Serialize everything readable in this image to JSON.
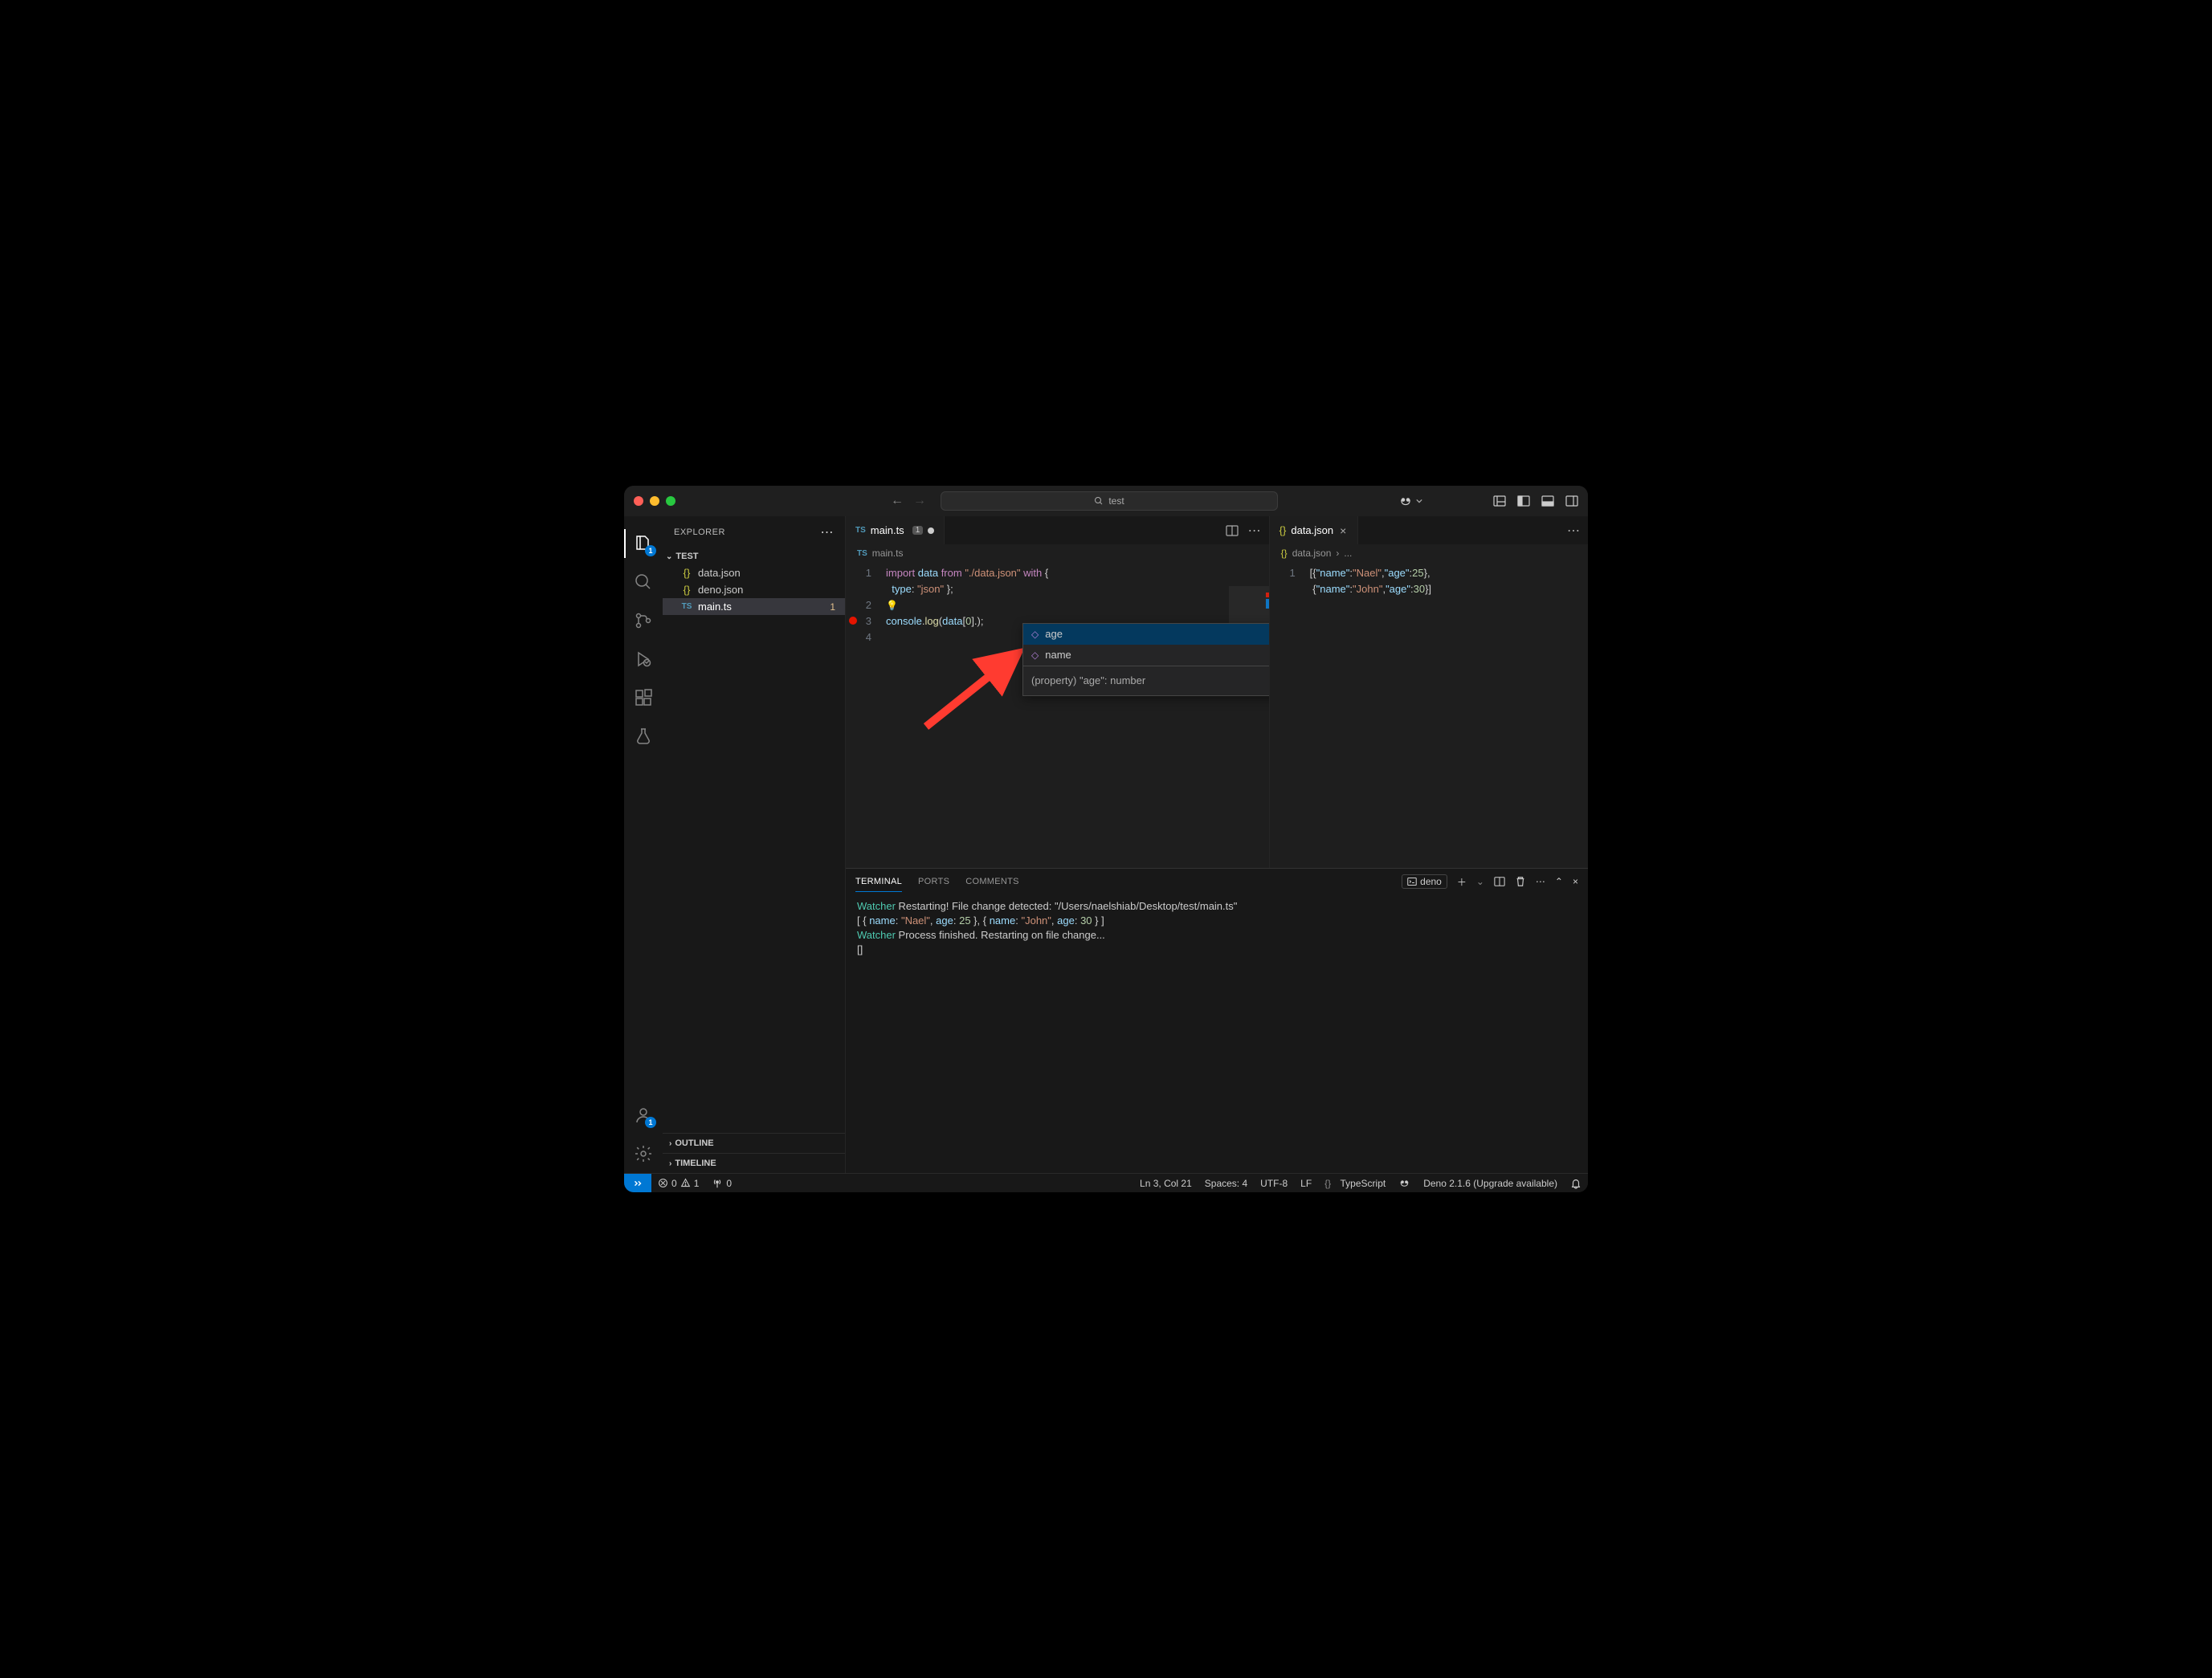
{
  "titlebar": {
    "search": "test"
  },
  "sidebar": {
    "title": "EXPLORER",
    "project": "TEST",
    "files": [
      {
        "name": "data.json",
        "icon": "json"
      },
      {
        "name": "deno.json",
        "icon": "json"
      },
      {
        "name": "main.ts",
        "icon": "ts",
        "selected": true,
        "modified": "1"
      }
    ],
    "collapsed": [
      {
        "label": "OUTLINE"
      },
      {
        "label": "TIMELINE"
      }
    ]
  },
  "editor1": {
    "tab": {
      "name": "main.ts",
      "num": "1",
      "dirty": true
    },
    "breadcrumb": {
      "file": "main.ts"
    },
    "lines": [
      {
        "n": "1",
        "tokens": [
          [
            "kw",
            "import"
          ],
          [
            "",
            ""
          ],
          [
            "var",
            "data"
          ],
          [
            "",
            ""
          ],
          [
            "kw",
            "from"
          ],
          [
            "",
            ""
          ],
          [
            "str",
            "\"./data.json\""
          ],
          [
            "",
            ""
          ],
          [
            "kw",
            "with"
          ],
          [
            "",
            ""
          ],
          [
            "punct",
            "{"
          ]
        ]
      },
      {
        "n": "",
        "tokens": [
          [
            "prop",
            "type"
          ],
          [
            "punct",
            ": "
          ],
          [
            "str",
            "\"json\""
          ],
          [
            "",
            ""
          ],
          [
            "punct",
            "};"
          ]
        ],
        "indent": 1
      },
      {
        "n": "2",
        "tokens": []
      },
      {
        "n": "3",
        "tokens": [
          [
            "var",
            "console"
          ],
          [
            "punct",
            "."
          ],
          [
            "fn",
            "log"
          ],
          [
            "punct",
            "("
          ],
          [
            "var",
            "data"
          ],
          [
            "punct",
            "["
          ],
          [
            "num",
            "0"
          ],
          [
            "punct",
            "]."
          ],
          [
            "punct",
            ");"
          ]
        ],
        "bp": true
      },
      {
        "n": "4",
        "tokens": []
      }
    ]
  },
  "suggest": {
    "items": [
      {
        "label": "age",
        "sel": true
      },
      {
        "label": "name"
      }
    ],
    "detail": "(property) \"age\": number"
  },
  "editor2": {
    "tab": {
      "name": "data.json"
    },
    "breadcrumb": {
      "file": "data.json",
      "more": "..."
    },
    "lines": [
      {
        "n": "1",
        "raw": "[{\"name\":\"Nael\",\"age\":25},"
      },
      {
        "n": "",
        "raw": " {\"name\":\"John\",\"age\":30}]"
      }
    ]
  },
  "panel": {
    "tabs": [
      {
        "label": "TERMINAL",
        "active": true
      },
      {
        "label": "PORTS"
      },
      {
        "label": "COMMENTS"
      }
    ],
    "shell": "deno",
    "terminal": {
      "l1a": "Watcher",
      "l1b": "Restarting! File change detected: \"/Users/naelshiab/Desktop/test/main.ts\"",
      "l2": "[ { name: \"Nael\", age: 25 }, { name: \"John\", age: 30 } ]",
      "l3a": "Watcher",
      "l3b": "Process finished. Restarting on file change...",
      "l4": "[]"
    }
  },
  "statusbar": {
    "errors": "0",
    "warnings": "1",
    "ports": "0",
    "lncol": "Ln 3, Col 21",
    "spaces": "Spaces: 4",
    "enc": "UTF-8",
    "eol": "LF",
    "lang": "TypeScript",
    "deno": "Deno 2.1.6 (Upgrade available)"
  },
  "activitybar": {
    "explorer_badge": "1",
    "accounts_badge": "1"
  }
}
